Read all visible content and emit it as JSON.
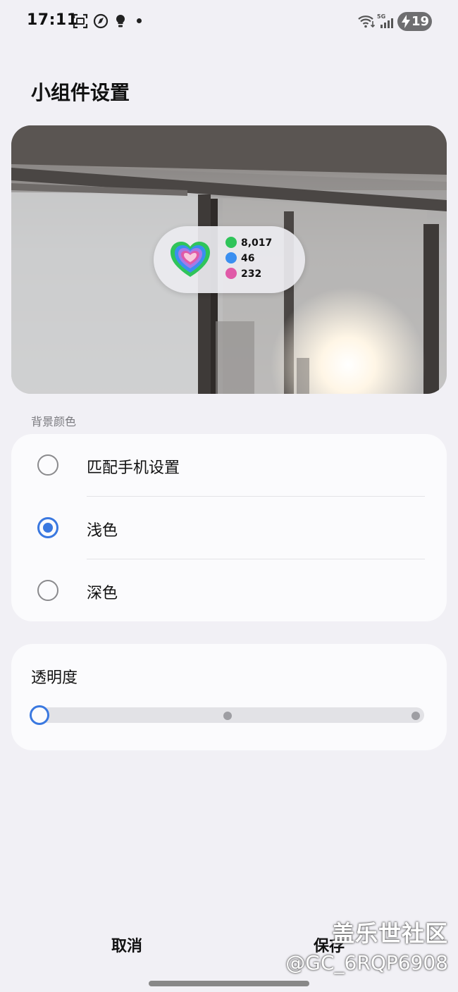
{
  "status_bar": {
    "time": "17:11",
    "battery": "19",
    "network": "5G"
  },
  "page": {
    "title": "小组件设置"
  },
  "widget_preview": {
    "stats": [
      {
        "icon": "steps-icon",
        "color": "#2fc45a",
        "value": "8,017"
      },
      {
        "icon": "active-time-icon",
        "color": "#3a8ff0",
        "value": "46"
      },
      {
        "icon": "calories-icon",
        "color": "#e05aa8",
        "value": "232"
      }
    ]
  },
  "background_color": {
    "label": "背景颜色",
    "options": [
      {
        "label": "匹配手机设置",
        "selected": false
      },
      {
        "label": "浅色",
        "selected": true
      },
      {
        "label": "深色",
        "selected": false
      }
    ]
  },
  "transparency": {
    "label": "透明度",
    "level": 0,
    "steps": 3
  },
  "actions": {
    "cancel": "取消",
    "save": "保存"
  },
  "watermark": {
    "line1": "盖乐世社区",
    "line2": "@GC_6RQP6908"
  },
  "colors": {
    "accent": "#3a78e0",
    "background": "#f1f0f5",
    "card": "#fbfbfd"
  }
}
